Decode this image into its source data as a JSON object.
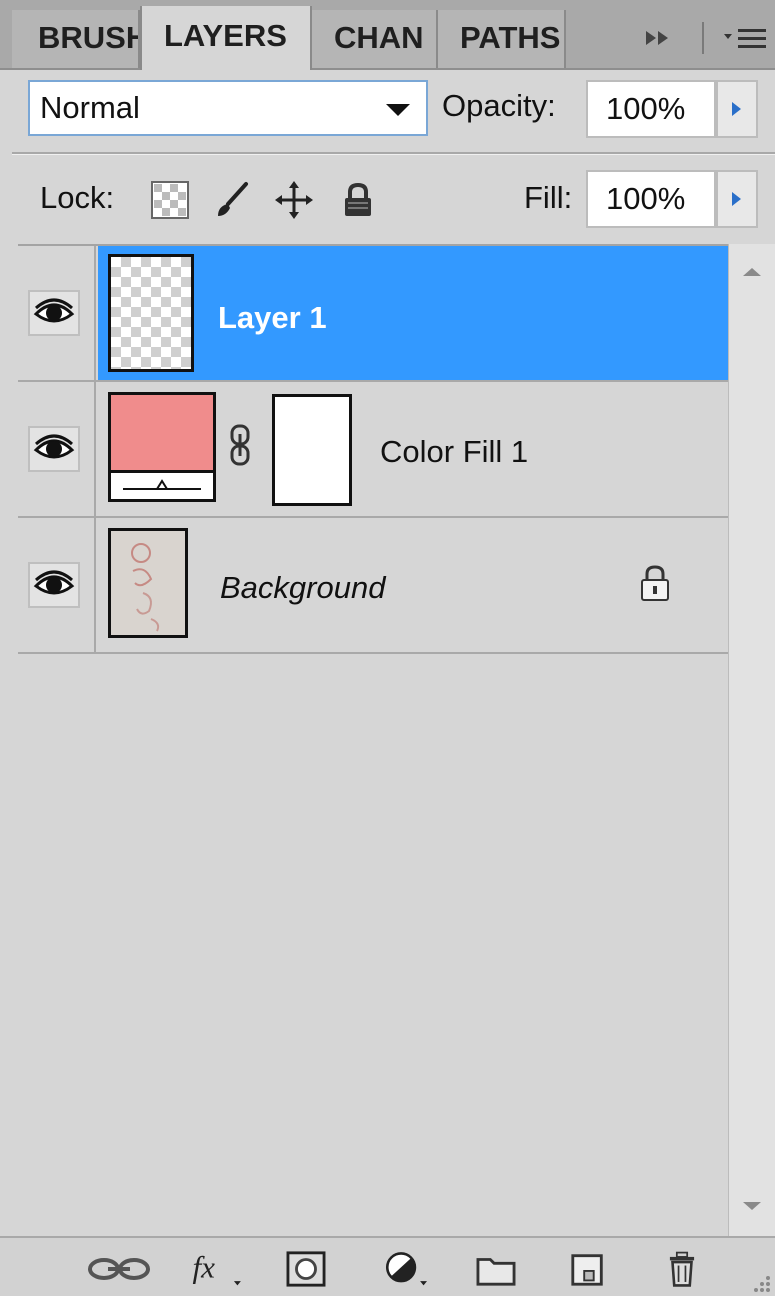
{
  "tabs": [
    {
      "label": "BRUSH",
      "active": false
    },
    {
      "label": "LAYERS",
      "active": true
    },
    {
      "label": "CHAN",
      "active": false
    },
    {
      "label": "PATHS",
      "active": false
    }
  ],
  "tab_icons": {
    "expand": "double-arrow-icon",
    "menu": "panel-menu-icon"
  },
  "blend_mode": {
    "value": "Normal"
  },
  "opacity": {
    "label": "Opacity:",
    "value": "100%"
  },
  "lock": {
    "label": "Lock:",
    "icons": [
      "lock-transparent-icon",
      "lock-image-icon",
      "lock-position-icon",
      "lock-all-icon"
    ]
  },
  "fill": {
    "label": "Fill:",
    "value": "100%"
  },
  "layers": [
    {
      "name": "Layer 1",
      "selected": true,
      "visible": true,
      "thumbnail": "transparent",
      "locked": false
    },
    {
      "name": "Color Fill 1",
      "selected": false,
      "visible": true,
      "thumbnail": "solid-color",
      "fill_color": "#f08c8c",
      "has_mask": true,
      "locked": false
    },
    {
      "name": "Background",
      "selected": false,
      "visible": true,
      "thumbnail": "image",
      "italic": true,
      "locked": true
    }
  ],
  "footer_icons": [
    "link-layers-icon",
    "fx-icon",
    "add-mask-icon",
    "adjustment-layer-icon",
    "new-group-icon",
    "new-layer-icon",
    "trash-icon"
  ],
  "colors": {
    "selection": "#3399ff",
    "panel_bg": "#d6d6d6",
    "accent_arrow": "#2a6fc9"
  }
}
